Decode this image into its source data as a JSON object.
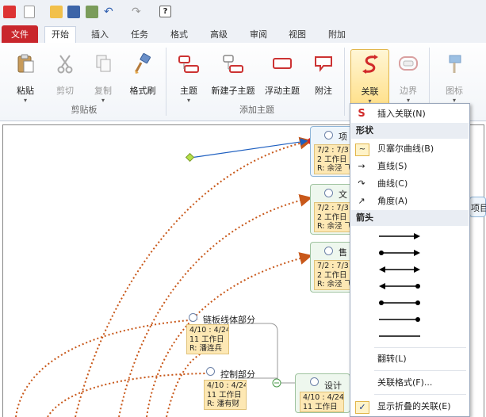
{
  "ribbon_tabs": [
    "文件",
    "开始",
    "插入",
    "任务",
    "格式",
    "高级",
    "审阅",
    "视图",
    "附加"
  ],
  "clipboard": {
    "paste": "粘贴",
    "cut": "剪切",
    "copy": "复制",
    "format_painter": "格式刷",
    "group": "剪贴板"
  },
  "add_topic": {
    "topic": "主题",
    "subtopic": "新建子主题",
    "floating": "浮动主题",
    "callout": "附注",
    "group": "添加主题"
  },
  "relation": {
    "relation": "关联",
    "boundary": "边界",
    "icon": "图标"
  },
  "menu": {
    "insert_relation": "插入关联(N)",
    "shape_header": "形状",
    "bezier": "贝塞尔曲线(B)",
    "straight": "直线(S)",
    "curve": "曲线(C)",
    "angle": "角度(A)",
    "arrow_header": "箭头",
    "flip": "翻转(L)",
    "format": "关联格式(F)...",
    "show_collapsed": "显示折叠的关联(E)",
    "show_collapsed_checked": true
  },
  "canvas": {
    "nodes": [
      {
        "title": "项",
        "dates": "7/2 : 7/3",
        "days": "2 工作日",
        "res": "R: 余泾 飞"
      },
      {
        "title": "文",
        "dates": "7/2 : 7/3",
        "days": "2 工作日",
        "res": "R: 余泾 飞"
      },
      {
        "title": "售",
        "dates": "7/2 : 7/3",
        "days": "2 工作日",
        "res": "R: 余泾 飞"
      },
      {
        "title": "链板线体部分",
        "dates": "4/10 : 4/24",
        "days": "11 工作日",
        "res": "R: 潘连兵"
      },
      {
        "title": "控制部分",
        "dates": "4/10 : 4/24",
        "days": "11 工作日",
        "res": "R: 潘有财"
      },
      {
        "title": "设计",
        "dates": "4/10 : 4/24",
        "days": "11 工作日",
        "res": ""
      }
    ],
    "right_label": "项目"
  }
}
